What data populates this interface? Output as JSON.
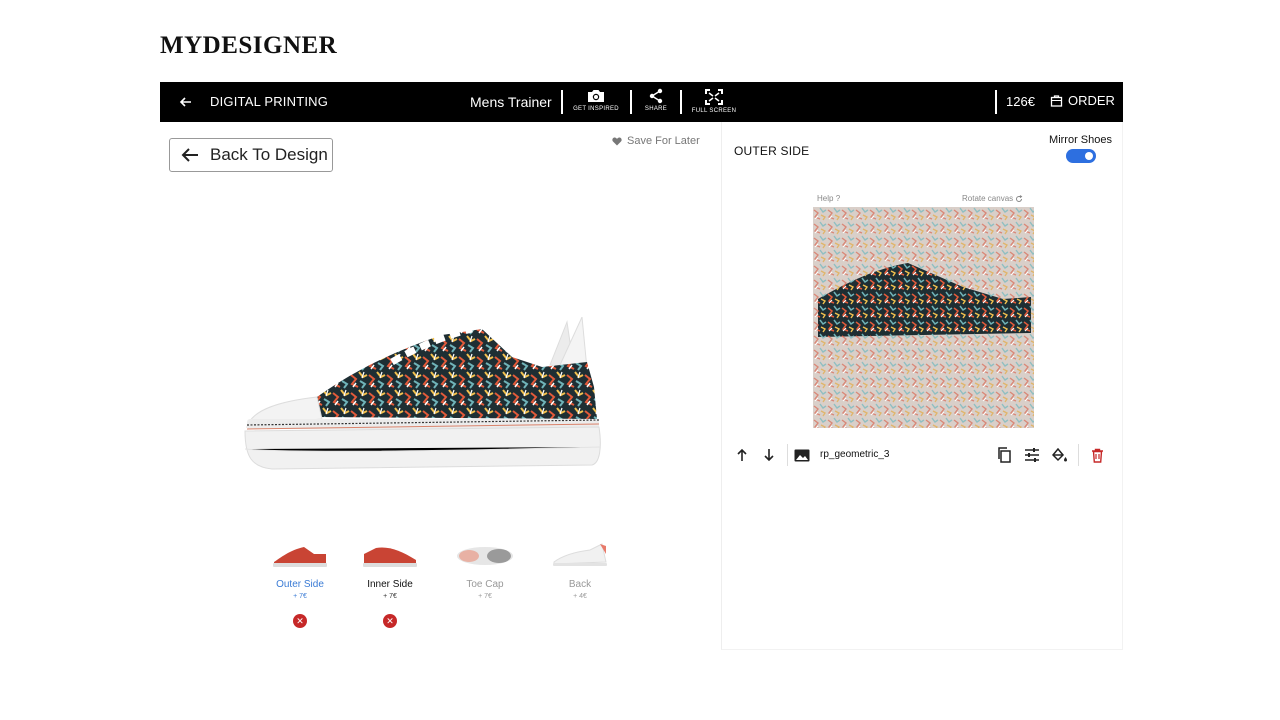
{
  "brand": {
    "logo": "MYDESIGNER"
  },
  "topbar": {
    "section_title": "DIGITAL PRINTING",
    "product_name": "Mens Trainer",
    "tools": [
      {
        "label": "GET INSPIRED",
        "icon": "camera-icon"
      },
      {
        "label": "SHARE",
        "icon": "share-icon"
      },
      {
        "label": "FULL SCREEN",
        "icon": "fullscreen-icon"
      }
    ],
    "price": "126€",
    "order_label": "ORDER"
  },
  "left": {
    "back_button": "Back To Design",
    "save_later": "Save For Later",
    "views": [
      {
        "label": "Outer Side",
        "price": "+ 7€",
        "state": "active",
        "removable": true
      },
      {
        "label": "Inner Side",
        "price": "+ 7€",
        "state": "normal",
        "removable": true
      },
      {
        "label": "Toe Cap",
        "price": "+ 7€",
        "state": "muted",
        "removable": false
      },
      {
        "label": "Back",
        "price": "+ 4€",
        "state": "muted",
        "removable": false
      }
    ]
  },
  "right": {
    "side_title": "OUTER SIDE",
    "mirror_label": "Mirror Shoes",
    "mirror_on": true,
    "canvas_help": "Help",
    "canvas_help_mark": "?",
    "canvas_rotate": "Rotate canvas",
    "layer_name": "rp_geometric_3"
  },
  "colors": {
    "accent": "#2d6fe0",
    "danger": "#c62828",
    "topbar_bg": "#000000"
  }
}
